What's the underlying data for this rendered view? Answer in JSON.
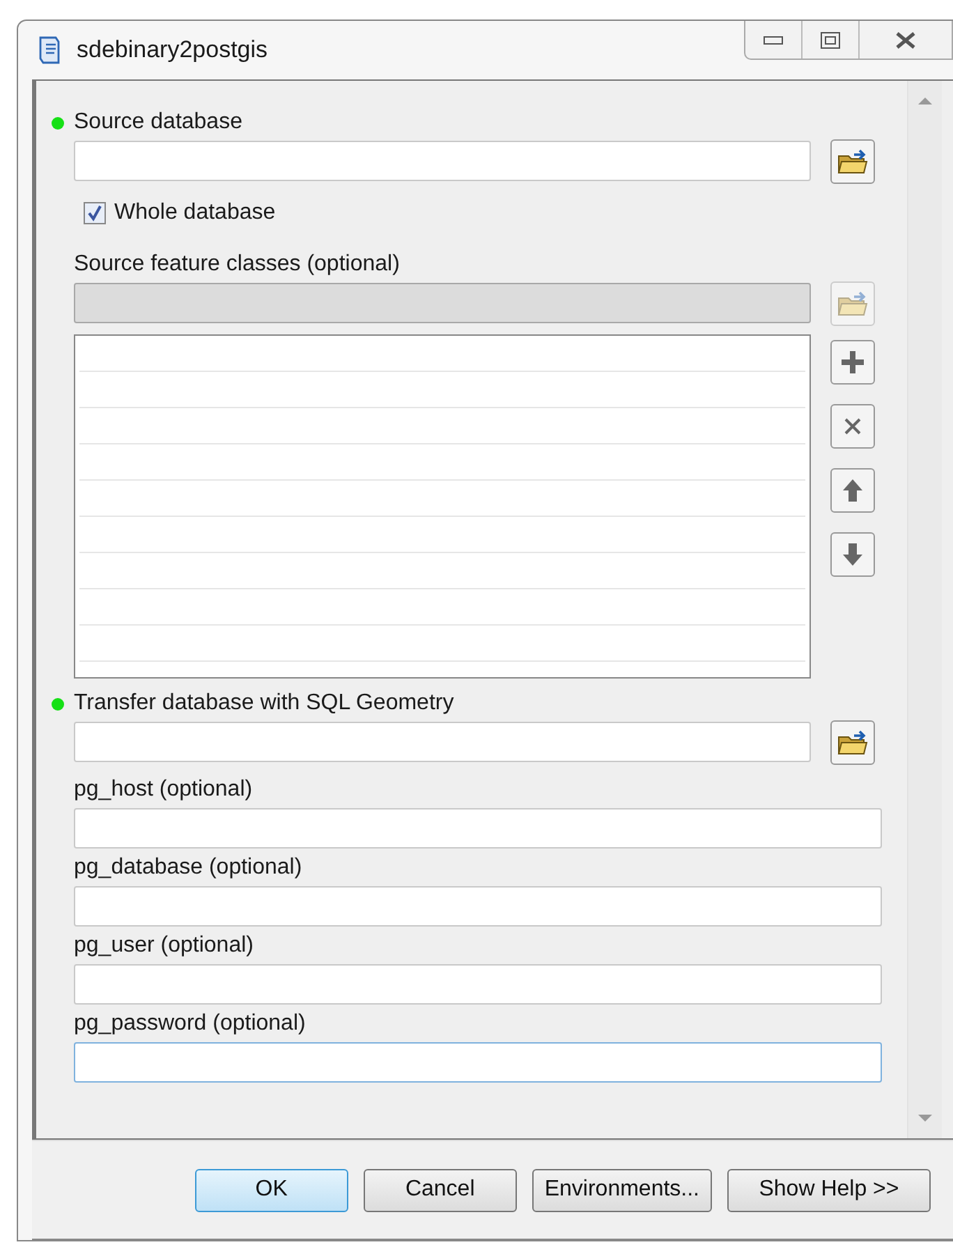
{
  "window": {
    "title": "sdebinary2postgis"
  },
  "params": [
    {
      "kind": "dataset",
      "label": "Source database",
      "required": true,
      "disabled": false
    },
    {
      "kind": "checkbox",
      "label": "Whole database",
      "checked": true
    },
    {
      "kind": "multivalue",
      "label": "Source feature classes (optional)",
      "required": false,
      "disabled": true
    },
    {
      "kind": "dataset",
      "label": "Transfer database with SQL Geometry",
      "required": true,
      "disabled": false
    },
    {
      "kind": "text",
      "label": "pg_host (optional)",
      "required": false,
      "focused": false
    },
    {
      "kind": "text",
      "label": "pg_database (optional)",
      "required": false,
      "focused": false
    },
    {
      "kind": "text",
      "label": "pg_user (optional)",
      "required": false,
      "focused": false
    },
    {
      "kind": "text",
      "label": "pg_password (optional)",
      "required": false,
      "focused": true
    }
  ],
  "buttons": [
    {
      "label": "OK",
      "default": true
    },
    {
      "label": "Cancel",
      "default": false
    },
    {
      "label": "Environments...",
      "default": false
    },
    {
      "label": "Show Help >>",
      "default": false
    }
  ]
}
